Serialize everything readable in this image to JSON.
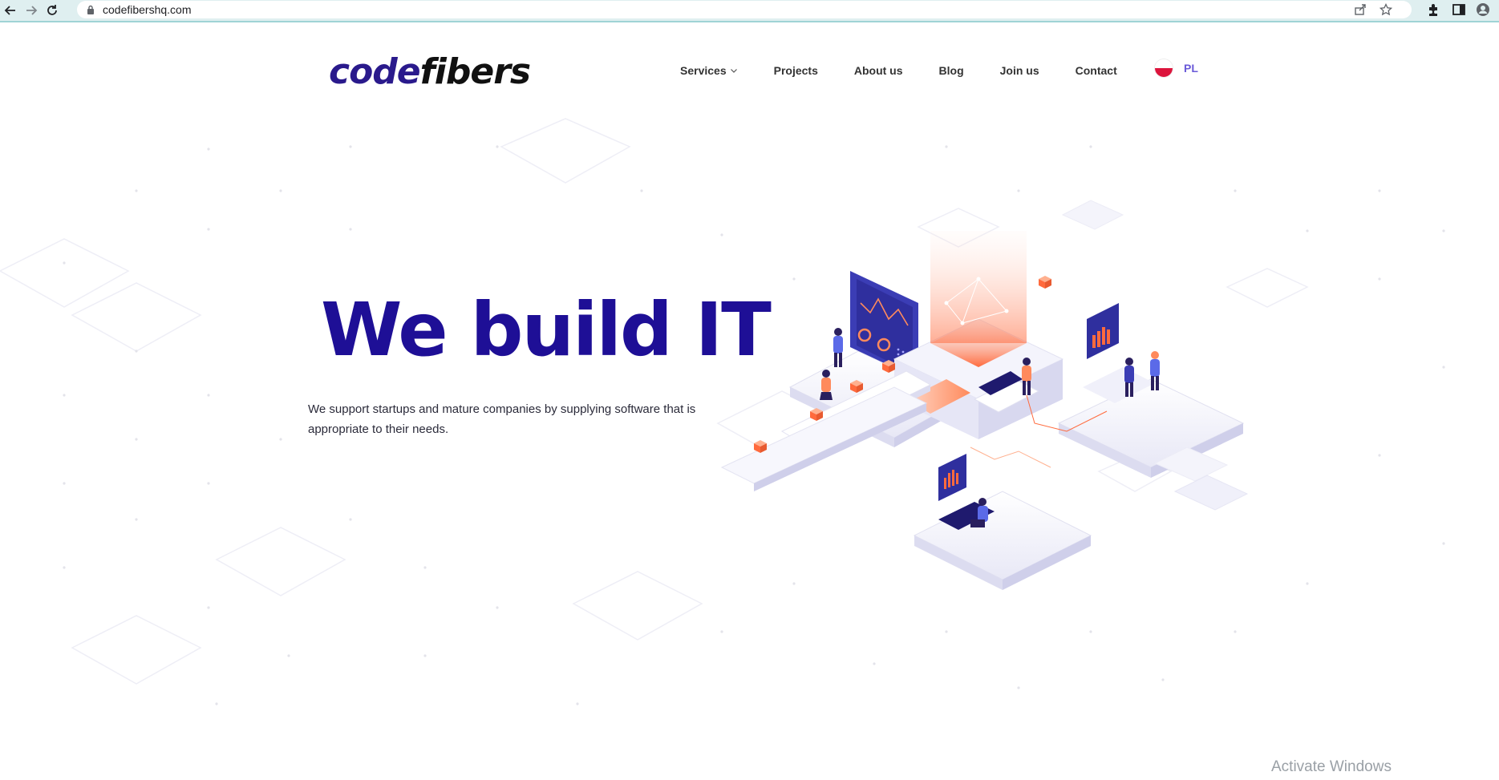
{
  "browser": {
    "url": "codefibershq.com",
    "icons": [
      "back-arrow-icon",
      "forward-arrow-icon",
      "reload-icon",
      "lock-icon",
      "share-icon",
      "star-icon",
      "extensions-icon",
      "side-panel-icon",
      "profile-icon"
    ]
  },
  "header": {
    "logo_part1": "code",
    "logo_part2": "fibers",
    "nav": [
      {
        "label": "Services",
        "has_dropdown": true
      },
      {
        "label": "Projects"
      },
      {
        "label": "About us"
      },
      {
        "label": "Blog"
      },
      {
        "label": "Join us"
      },
      {
        "label": "Contact"
      }
    ],
    "language": "PL"
  },
  "hero": {
    "title": "We build IT",
    "description": "We support startups and mature companies by supplying software that is appropriate to their needs."
  },
  "overlay": {
    "watermark": "Activate Windows"
  },
  "colors": {
    "brand": "#1e0f96",
    "accent": "#6a5ad8",
    "orange": "#ff7a4a",
    "chrome": "#dfeff0"
  }
}
